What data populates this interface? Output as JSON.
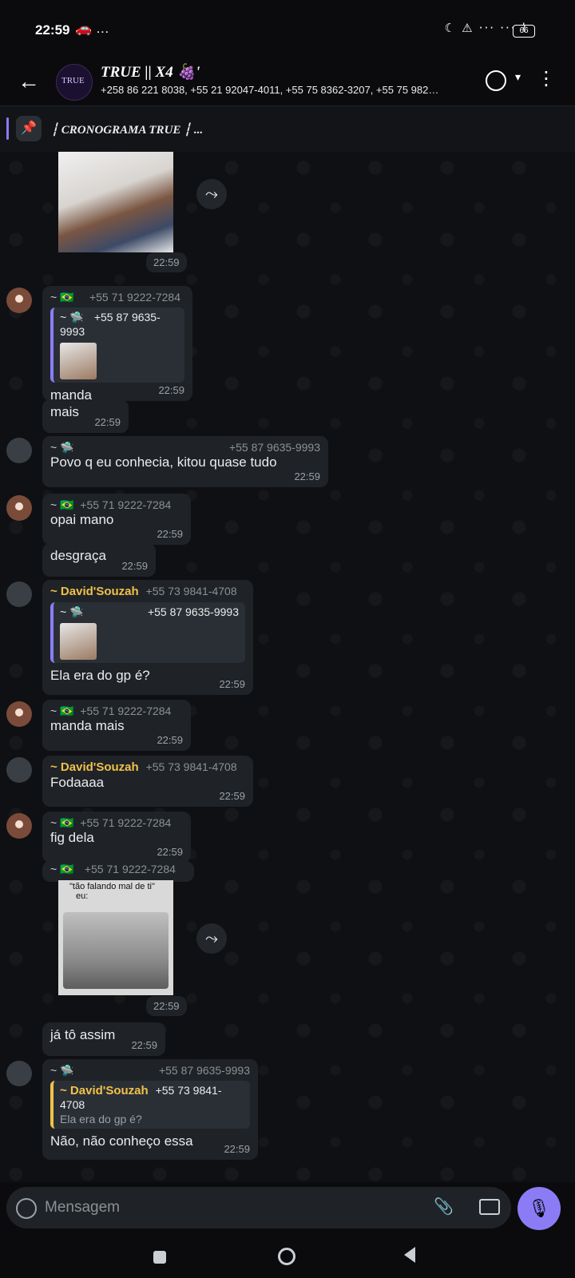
{
  "status_bar": {
    "time": "22:59",
    "extra": "🚗 …",
    "right_icons": "☾ ⚠ ‧‧‧ ‧‧‧ ⌇",
    "battery": "66"
  },
  "header": {
    "back_icon": "←",
    "avatar_text": "TRUE",
    "title": "TRUE || X4 🍇'",
    "members": "+258 86 221 8038, +55 21 92047-4011, +55 75 8362-3207, +55 75 982…",
    "call_caret": "▾",
    "menu_icon": "⋮"
  },
  "pinned": {
    "icon": "📌",
    "text": "┆ CRONOGRAMA TRUE ┆ ..."
  },
  "messages": {
    "m1": {
      "time": "22:59",
      "forward": "⤳"
    },
    "m2": {
      "sender": "~ 🇧🇷",
      "phone": "+55 71 9222-7284",
      "quote_name": "~ 🛸",
      "quote_phone": "+55 87 9635-9993",
      "text": "manda",
      "time": "22:59"
    },
    "m3": {
      "text": "mais",
      "time": "22:59"
    },
    "m4": {
      "sender": "~ 🛸",
      "phone": "+55 87 9635-9993",
      "text": "Povo q eu conhecia, kitou quase tudo",
      "time": "22:59"
    },
    "m5": {
      "sender": "~ 🇧🇷",
      "phone": "+55 71 9222-7284",
      "text": "opai mano",
      "time": "22:59"
    },
    "m6": {
      "text": "desgraça",
      "time": "22:59"
    },
    "m7": {
      "sender": "~ David'Souzah",
      "phone": "+55 73 9841-4708",
      "quote_name": "~ 🛸",
      "quote_phone": "+55 87 9635-9993",
      "text": "Ela era do gp é?",
      "time": "22:59"
    },
    "m8": {
      "sender": "~ 🇧🇷",
      "phone": "+55 71 9222-7284",
      "text": "manda mais",
      "time": "22:59"
    },
    "m9": {
      "sender": "~ David'Souzah",
      "phone": "+55 73 9841-4708",
      "text": "Fodaaaa",
      "time": "22:59"
    },
    "m10": {
      "sender": "~ 🇧🇷",
      "phone": "+55 71 9222-7284",
      "text": "fig dela",
      "time": "22:59"
    },
    "m11": {
      "sender": "~ 🇧🇷",
      "phone": "+55 71 9222-7284",
      "caption_top": "\"tão falando mal de ti\"",
      "caption_bottom": "eu:",
      "time": "22:59",
      "forward": "⤳"
    },
    "m12": {
      "text": "já tô assim",
      "time": "22:59"
    },
    "m13": {
      "sender": "~ 🛸",
      "phone": "+55 87 9635-9993",
      "quote_name": "~ David'Souzah",
      "quote_phone": "+55 73 9841-4708",
      "quote_text": "Ela era do gp é?",
      "text": "Não, não conheço essa",
      "time": "22:59"
    }
  },
  "composer": {
    "placeholder": "Mensagem",
    "clip_icon": "📎",
    "mic_icon": "🎙"
  },
  "colors": {
    "accent": "#8b7cf6",
    "bubble": "#1f2327",
    "gold_name": "#f0c14b",
    "background": "#0f1013"
  }
}
